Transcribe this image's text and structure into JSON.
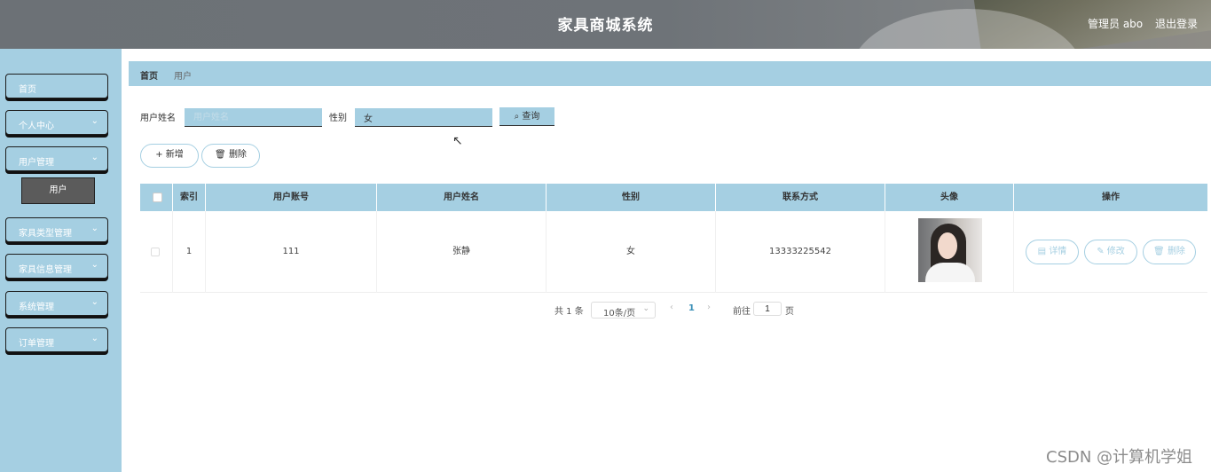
{
  "header": {
    "title": "家具商城系统",
    "admin_label": "管理员 abo",
    "logout_label": "退出登录"
  },
  "sidebar": {
    "items": [
      {
        "label": "首页"
      },
      {
        "label": "个人中心"
      },
      {
        "label": "用户管理"
      },
      {
        "label": "家具类型管理"
      },
      {
        "label": "家具信息管理"
      },
      {
        "label": "系统管理"
      },
      {
        "label": "订单管理"
      }
    ],
    "sub_item": "用户"
  },
  "breadcrumb": {
    "home": "首页",
    "current": "用户"
  },
  "search": {
    "name_label": "用户姓名",
    "name_placeholder": "用户姓名",
    "name_value": "",
    "gender_label": "性别",
    "gender_value": "女",
    "query_label": "查询"
  },
  "actions": {
    "add_label": "新增",
    "delete_label": "删除"
  },
  "table": {
    "headers": [
      "索引",
      "用户账号",
      "用户姓名",
      "性别",
      "联系方式",
      "头像",
      "操作"
    ],
    "rows": [
      {
        "index": "1",
        "account": "111",
        "name": "张静",
        "gender": "女",
        "phone": "13333225542"
      }
    ],
    "row_actions": {
      "detail": "详情",
      "edit": "修改",
      "delete": "删除"
    }
  },
  "pagination": {
    "total": "共 1 条",
    "page_size": "10条/页",
    "current_page": "1",
    "goto_label": "前往",
    "goto_value": "1",
    "page_unit": "页"
  },
  "watermark": "CSDN @计算机学姐",
  "colors": {
    "accent": "#a5cfe2",
    "header": "#6e7378"
  }
}
